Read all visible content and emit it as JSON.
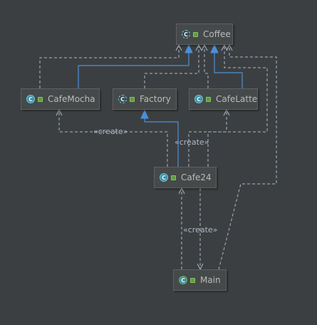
{
  "colors": {
    "background": "#3c3f41",
    "dependency_line": "#a9b7c6",
    "inheritance_line": "#4a90d9",
    "class_icon": "#3f8ea3",
    "visibility_badge": "#5f9d3c"
  },
  "nodes": {
    "coffee": {
      "name": "Coffee",
      "icon": "abstract-class-icon",
      "icon_letter": "C"
    },
    "cafemocha": {
      "name": "CafeMocha",
      "icon": "class-icon",
      "icon_letter": "C"
    },
    "factory": {
      "name": "Factory",
      "icon": "abstract-class-icon",
      "icon_letter": "C"
    },
    "cafelatte": {
      "name": "CafeLatte",
      "icon": "class-icon",
      "icon_letter": "C"
    },
    "cafe24": {
      "name": "Cafe24",
      "icon": "class-icon",
      "icon_letter": "C"
    },
    "main": {
      "name": "Main",
      "icon": "main-class-icon",
      "icon_letter": "C"
    }
  },
  "labels": {
    "create_mocha": "«create»",
    "create_latte": "«create»",
    "create_cafe24": "«create»"
  },
  "edges": [
    {
      "from": "cafemocha",
      "to": "coffee",
      "kind": "inheritance"
    },
    {
      "from": "cafelatte",
      "to": "coffee",
      "kind": "inheritance"
    },
    {
      "from": "cafe24",
      "to": "factory",
      "kind": "inheritance"
    },
    {
      "from": "cafemocha",
      "to": "coffee",
      "kind": "dependency"
    },
    {
      "from": "factory",
      "to": "coffee",
      "kind": "dependency"
    },
    {
      "from": "cafelatte",
      "to": "coffee",
      "kind": "dependency"
    },
    {
      "from": "cafe24",
      "to": "coffee",
      "kind": "dependency"
    },
    {
      "from": "main",
      "to": "coffee",
      "kind": "dependency"
    },
    {
      "from": "cafe24",
      "to": "cafemocha",
      "kind": "create"
    },
    {
      "from": "cafe24",
      "to": "cafelatte",
      "kind": "create"
    },
    {
      "from": "main",
      "to": "cafe24",
      "kind": "create"
    },
    {
      "from": "cafe24",
      "to": "main",
      "kind": "dependency"
    }
  ]
}
